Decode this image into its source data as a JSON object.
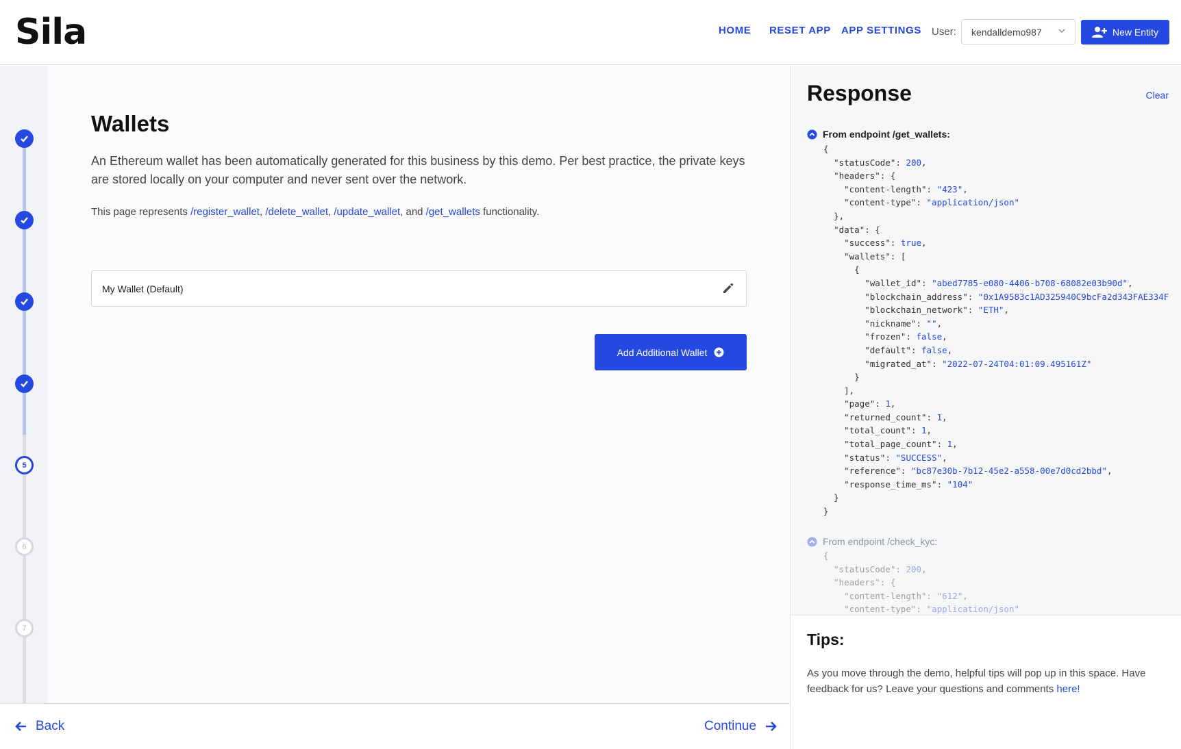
{
  "header": {
    "logo": "Sila",
    "nav": [
      {
        "label": "HOME"
      },
      {
        "label": "RESET APP"
      },
      {
        "label": "APP SETTINGS"
      }
    ],
    "user_label": "User:",
    "user_value": "kendalldemo987",
    "new_entity_label": "New Entity"
  },
  "stepper": {
    "steps": [
      {
        "number": "1",
        "state": "done"
      },
      {
        "number": "2",
        "state": "done"
      },
      {
        "number": "3",
        "state": "done"
      },
      {
        "number": "4",
        "state": "done"
      },
      {
        "number": "5",
        "state": "current"
      },
      {
        "number": "6",
        "state": "todo"
      },
      {
        "number": "7",
        "state": "todo"
      }
    ]
  },
  "main": {
    "title": "Wallets",
    "intro": "An Ethereum wallet has been automatically generated for this business by this demo. Per best practice, the private keys are stored locally on your computer and never sent over the network.",
    "represents_prefix": "This page represents ",
    "links": [
      "/register_wallet",
      "/delete_wallet",
      "/update_wallet",
      "/get_wallets"
    ],
    "sep1": ", ",
    "sep2": ", ",
    "sep3": ", and ",
    "represents_suffix": " functionality.",
    "wallet_name": "My Wallet (Default)",
    "add_wallet_label": "Add Additional Wallet"
  },
  "footer": {
    "back_label": "Back",
    "continue_label": "Continue"
  },
  "response": {
    "title": "Response",
    "clear_label": "Clear",
    "endpoint1": "From endpoint /get_wallets:",
    "endpoint2": "From endpoint /check_kyc:",
    "get_wallets": {
      "statusCode": "200",
      "content_length": "\"423\"",
      "content_type": "\"application/json\"",
      "success": "true",
      "wallet_id": "\"abed7785-e080-4406-b708-68082e03b90d\"",
      "blockchain_address": "\"0x1A9583c1AD325940C9bcFa2d343FAE334F",
      "blockchain_network": "\"ETH\"",
      "nickname": "\"\"",
      "frozen": "false",
      "default": "false",
      "migrated_at": "\"2022-07-24T04:01:09.495161Z\"",
      "page": "1",
      "returned_count": "1",
      "total_count": "1",
      "total_page_count": "1",
      "status": "\"SUCCESS\"",
      "reference": "\"bc87e30b-7b12-45e2-a558-00e7d0cd2bbd\"",
      "response_time_ms": "\"104\""
    },
    "check_kyc": {
      "statusCode": "200",
      "content_length": "\"612\"",
      "content_type": "\"application/json\""
    }
  },
  "tips": {
    "title": "Tips:",
    "text": "As you move through the demo, helpful tips will pop up in this space. Have feedback for us? Leave your questions and comments ",
    "link": "here!"
  },
  "colors": {
    "accent": "#2448e0",
    "step_line_done": "#b7c3f3",
    "step_line_todo": "#dcdde2"
  }
}
